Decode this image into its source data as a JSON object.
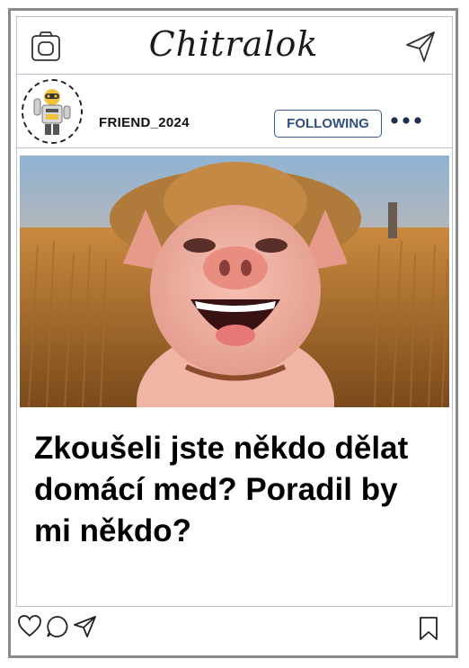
{
  "app": {
    "brand": "Chitralok"
  },
  "header": {
    "left_icon": "camera-icon",
    "right_icon": "send-icon"
  },
  "post": {
    "username": "FRIEND_2024",
    "follow_label": "FOLLOWING",
    "more_icon": "more-dots-icon",
    "avatar": "robot-avatar",
    "image": "laughing-pig-in-wheat-field",
    "caption": "Zkoušeli jste někdo dělat domácí med? Poradil by mi někdo?"
  },
  "actions": {
    "like_icon": "heart-icon",
    "comment_icon": "comment-icon",
    "share_icon": "share-icon",
    "save_icon": "bookmark-icon"
  },
  "colors": {
    "follow_border": "#3a5a8c",
    "follow_text": "#2f4f80",
    "frame": "#8a8a8a"
  }
}
